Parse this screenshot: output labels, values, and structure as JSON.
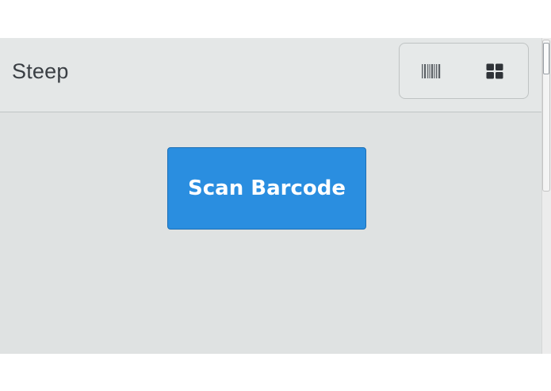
{
  "header": {
    "title": "Steep",
    "view_toggle": {
      "left_icon": "barcode-icon",
      "right_icon": "grid-icon"
    }
  },
  "main": {
    "scan_button_label": "Scan Barcode"
  },
  "colors": {
    "accent": "#2a8ee0",
    "header_bg": "#e4e7e7",
    "content_bg": "#dfe2e2",
    "title_text": "#3a3f44"
  }
}
